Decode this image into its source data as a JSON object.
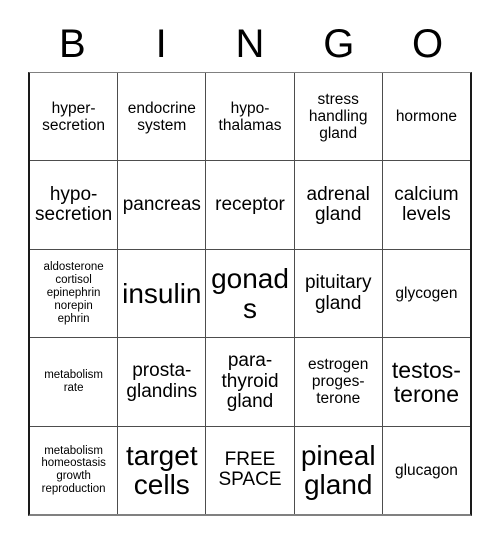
{
  "header": {
    "letters": [
      "B",
      "I",
      "N",
      "G",
      "O"
    ]
  },
  "grid": {
    "rows": [
      [
        {
          "text": "hyper-\nsecretion",
          "size": "sm"
        },
        {
          "text": "endocrine\nsystem",
          "size": "sm"
        },
        {
          "text": "hypo-\nthalamas",
          "size": "sm"
        },
        {
          "text": "stress\nhandling\ngland",
          "size": "sm"
        },
        {
          "text": "hormone",
          "size": "sm"
        }
      ],
      [
        {
          "text": "hypo-\nsecretion",
          "size": "md"
        },
        {
          "text": "pancreas",
          "size": "md"
        },
        {
          "text": "receptor",
          "size": "md"
        },
        {
          "text": "adrenal\ngland",
          "size": "md"
        },
        {
          "text": "calcium\nlevels",
          "size": "md"
        }
      ],
      [
        {
          "text": "aldosterone\ncortisol\nepinephrin\nnorepin\nephrin",
          "size": "xs"
        },
        {
          "text": "insulin",
          "size": "xl"
        },
        {
          "text": "gonads",
          "size": "xl"
        },
        {
          "text": "pituitary\ngland",
          "size": "md"
        },
        {
          "text": "glycogen",
          "size": "sm"
        }
      ],
      [
        {
          "text": "metabolism\nrate",
          "size": "xs"
        },
        {
          "text": "prosta-\nglandins",
          "size": "md"
        },
        {
          "text": "para-\nthyroid\ngland",
          "size": "md"
        },
        {
          "text": "estrogen\nproges-\nterone",
          "size": "sm"
        },
        {
          "text": "testos-\nterone",
          "size": "lg"
        }
      ],
      [
        {
          "text": "metabolism\nhomeostasis\ngrowth\nreproduction",
          "size": "xs"
        },
        {
          "text": "target\ncells",
          "size": "xl"
        },
        {
          "text": "FREE\nSPACE",
          "size": "md"
        },
        {
          "text": "pineal\ngland",
          "size": "xl"
        },
        {
          "text": "glucagon",
          "size": "sm"
        }
      ]
    ]
  }
}
